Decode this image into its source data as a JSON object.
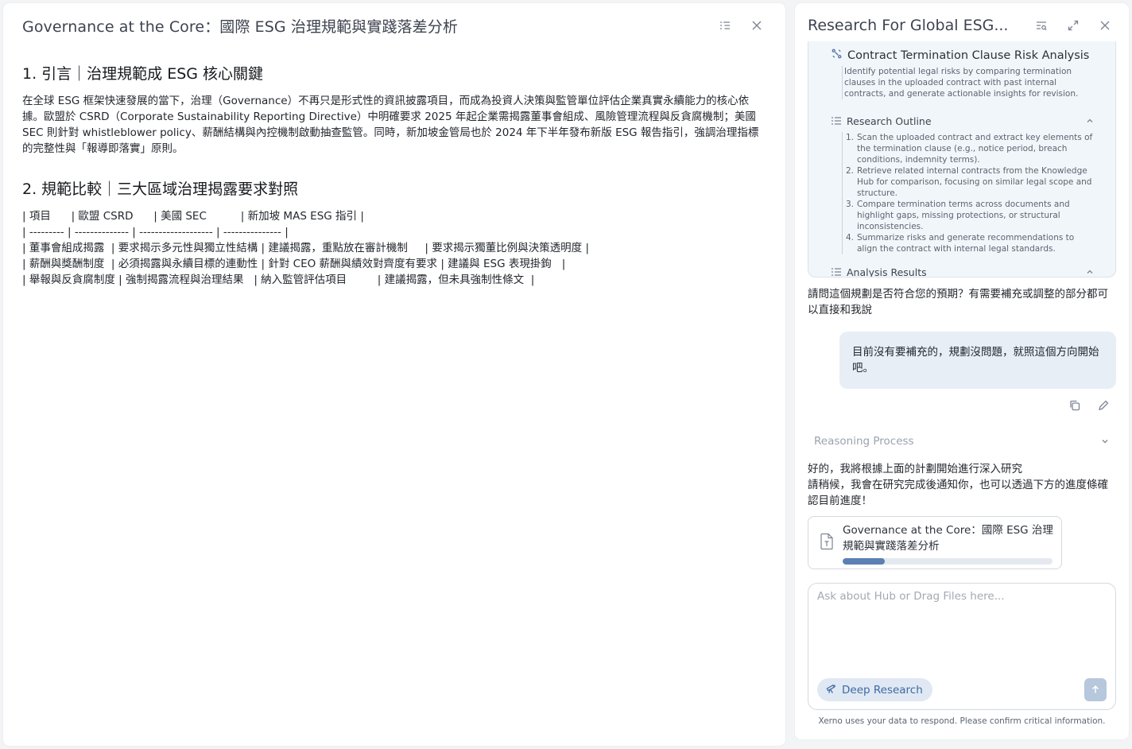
{
  "document": {
    "title": "Governance at the Core：國際 ESG 治理規範與實踐落差分析",
    "section1_heading": "1. 引言｜治理規範成 ESG 核心關鍵",
    "section1_body": "在全球 ESG 框架快速發展的當下，治理（Governance）不再只是形式性的資訊披露項目，而成為投資人決策與監管單位評估企業真實永續能力的核心依據。歐盟於 CSRD（Corporate Sustainability Reporting Directive）中明確要求 2025 年起企業需揭露董事會組成、風險管理流程與反貪腐機制；美國 SEC 則針對 whistleblower policy、薪酬結構與內控機制啟動抽查監管。同時，新加坡金管局也於 2024 年下半年發布新版 ESG 報告指引，強調治理指標的完整性與「報導即落實」原則。",
    "section2_heading": "2. 規範比較｜三大區域治理揭露要求對照",
    "table_lines": [
      "| 項目      | 歐盟 CSRD      | 美國 SEC          | 新加坡 MAS ESG 指引 |",
      "| --------- | -------------- | ------------------- | --------------- |",
      "| 董事會組成揭露  | 要求揭示多元性與獨立性結構 | 建議揭露，重點放在審計機制     | 要求揭示獨董比例與決策透明度 |",
      "| 薪酬與獎酬制度  | 必須揭露與永續目標的連動性 | 針對 CEO 薪酬與績效對齊度有要求 | 建議與 ESG 表現掛鉤   |",
      "| 舉報與反貪腐制度 | 強制揭露流程與治理結果   | 納入監管評估項目         | 建議揭露，但未具強制性條文  |"
    ]
  },
  "chat": {
    "title": "Research For Global ESG...",
    "plan": {
      "title": "Contract Termination Clause Risk Analysis",
      "description": "Identify potential legal risks by comparing termination clauses in the uploaded contract with past internal contracts, and generate actionable insights for revision.",
      "outline_label": "Research Outline",
      "outline": [
        {
          "num": "1.",
          "text": "Scan the uploaded contract and extract key elements of the termination clause (e.g., notice period, breach conditions, indemnity terms)."
        },
        {
          "num": "2.",
          "text": "Retrieve related internal contracts from the Knowledge Hub for comparison, focusing on similar legal scope and structure."
        },
        {
          "num": "3.",
          "text": "Compare termination terms across documents and highlight gaps, missing protections, or structural inconsistencies."
        },
        {
          "num": "4.",
          "text": "Summarize risks and generate recommendations to align the contract with internal legal standards."
        }
      ],
      "analysis_label": "Analysis Results"
    },
    "assistant_question": "請問這個規劃是否符合您的預期？有需要補充或調整的部分都可以直接和我說",
    "user_message": "目前沒有要補充的，規劃沒問題，就照這個方向開始吧。",
    "reasoning_label": "Reasoning Process",
    "assistant_reply_line1": "好的，我將根據上面的計劃開始進行深入研究",
    "assistant_reply_line2": "請稍候，我會在研究完成後通知你，也可以透過下方的進度條確認目前進度！",
    "report": {
      "title": "Governance at the Core：國際 ESG 治理規範與實踐落差分析",
      "progress": 0.2
    },
    "input_placeholder": "Ask about Hub or Drag Files here...",
    "deep_research_label": "Deep Research",
    "footer_note": "Xerno uses your data to respond. Please confirm critical information."
  },
  "colors": {
    "accent": "#3d6aa3",
    "progress": "#5b80b3",
    "plan_bg": "#f1f6fa",
    "user_bubble": "#e7eef6"
  },
  "icons": [
    "outline-toggle-icon",
    "close-icon",
    "search-list-icon",
    "expand-icon",
    "sparkle-icon",
    "list-icon",
    "chevron-up-icon",
    "chevron-down-icon",
    "copy-icon",
    "edit-icon",
    "file-text-icon",
    "telescope-icon",
    "arrow-up-icon"
  ]
}
